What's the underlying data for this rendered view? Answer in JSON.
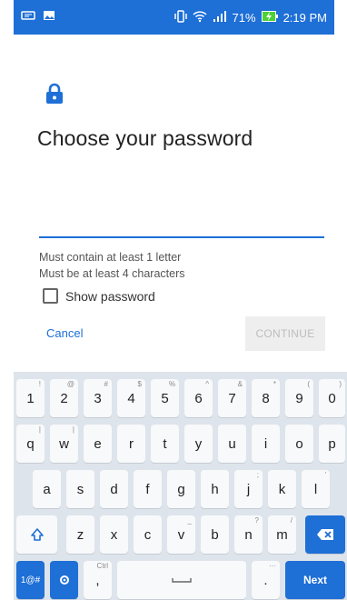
{
  "status_bar": {
    "battery": "71%",
    "time": "2:19 PM"
  },
  "page": {
    "title": "Choose your password",
    "input": {
      "value": "",
      "placeholder": ""
    },
    "hints": [
      "Must contain at least 1 letter",
      "Must be at least 4 characters"
    ],
    "show_password_label": "Show password",
    "cancel_label": "Cancel",
    "continue_label": "CONTINUE"
  },
  "colors": {
    "accent": "#1e6fd6",
    "keyboard_bg": "#dee4eb",
    "disabled_text": "#bdbdbd"
  },
  "keyboard": {
    "row1": [
      {
        "k": "1",
        "alt": "!"
      },
      {
        "k": "2",
        "alt": "@"
      },
      {
        "k": "3",
        "alt": "#"
      },
      {
        "k": "4",
        "alt": "$"
      },
      {
        "k": "5",
        "alt": "%"
      },
      {
        "k": "6",
        "alt": "^"
      },
      {
        "k": "7",
        "alt": "&"
      },
      {
        "k": "8",
        "alt": "*"
      },
      {
        "k": "9",
        "alt": "("
      },
      {
        "k": "0",
        "alt": ")"
      }
    ],
    "row2": [
      {
        "k": "q",
        "alt": "|"
      },
      {
        "k": "w",
        "alt": "|"
      },
      {
        "k": "e",
        "alt": ""
      },
      {
        "k": "r",
        "alt": ""
      },
      {
        "k": "t",
        "alt": ""
      },
      {
        "k": "y",
        "alt": ""
      },
      {
        "k": "u",
        "alt": ""
      },
      {
        "k": "i",
        "alt": ""
      },
      {
        "k": "o",
        "alt": ""
      },
      {
        "k": "p",
        "alt": ""
      }
    ],
    "row3": [
      {
        "k": "a",
        "alt": ""
      },
      {
        "k": "s",
        "alt": ""
      },
      {
        "k": "d",
        "alt": ""
      },
      {
        "k": "f",
        "alt": ""
      },
      {
        "k": "g",
        "alt": ""
      },
      {
        "k": "h",
        "alt": ""
      },
      {
        "k": "j",
        "alt": ";"
      },
      {
        "k": "k",
        "alt": ""
      },
      {
        "k": "l",
        "alt": "'"
      }
    ],
    "row4": [
      {
        "k": "z",
        "alt": ""
      },
      {
        "k": "x",
        "alt": ""
      },
      {
        "k": "c",
        "alt": ""
      },
      {
        "k": "v",
        "alt": "_"
      },
      {
        "k": "b",
        "alt": ""
      },
      {
        "k": "n",
        "alt": "?"
      },
      {
        "k": "m",
        "alt": "/"
      }
    ],
    "sym_label": "1@#",
    "ctrl_alt": "Ctrl",
    "period": ".",
    "comma": ",",
    "next_label": "Next"
  }
}
